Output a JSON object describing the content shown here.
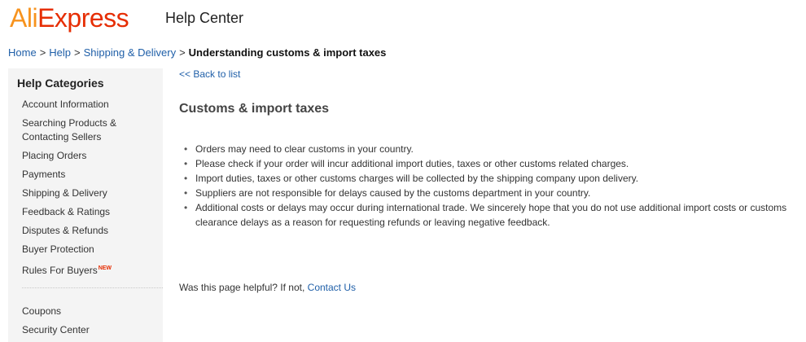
{
  "header": {
    "logo_part1": "Ali",
    "logo_part2": "Express",
    "title": "Help Center"
  },
  "breadcrumb": {
    "items": [
      "Home",
      "Help",
      "Shipping & Delivery"
    ],
    "separator": ">",
    "current": "Understanding customs & import taxes"
  },
  "sidebar": {
    "heading": "Help Categories",
    "items": [
      "Account Information",
      "Searching Products & Contacting Sellers",
      "Placing Orders",
      "Payments",
      "Shipping & Delivery",
      "Feedback & Ratings",
      "Disputes & Refunds",
      "Buyer Protection",
      "Rules For Buyers"
    ],
    "new_badge": "NEW",
    "secondary_items": [
      "Coupons",
      "Security Center"
    ]
  },
  "main": {
    "back_link": "<< Back to list",
    "title": "Customs & import taxes",
    "bullets": [
      "Orders may need to clear customs in your country.",
      "Please check if your order will incur additional import duties, taxes or other customs related charges.",
      "Import duties, taxes or other customs charges will be collected by the shipping company upon delivery.",
      "Suppliers are not responsible for delays caused by the customs department in your country.",
      "Additional costs or delays may occur during international trade. We sincerely hope that you do not use additional import costs or customs clearance delays as a reason for requesting refunds or leaving negative feedback."
    ],
    "helpful_text": "Was this page helpful? If not, ",
    "contact_link": "Contact Us"
  },
  "colors": {
    "logo_orange": "#f7931e",
    "logo_red": "#e62e04",
    "link": "#1f5fa8",
    "sidebar_bg": "#f4f4f4"
  }
}
